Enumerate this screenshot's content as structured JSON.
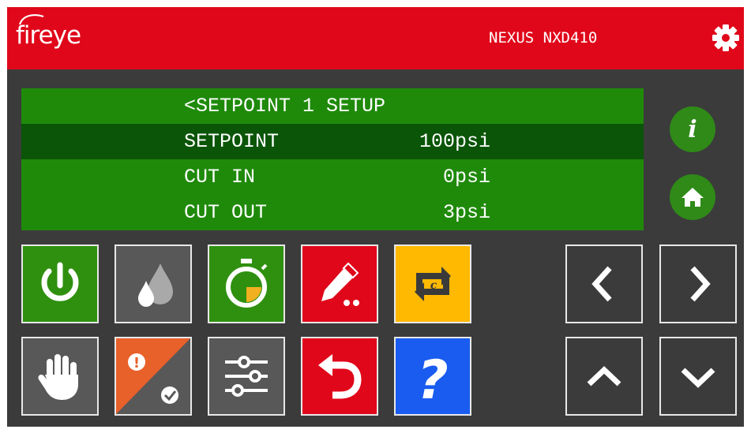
{
  "header": {
    "logo_text": "fireye",
    "model_name": "NEXUS NXD410",
    "settings_icon": "gear-icon"
  },
  "colors": {
    "header_red": "#e0071a",
    "panel_bg": "#3b3b3b",
    "lcd_green": "#1f8a0a",
    "lcd_selected": "#0a5508",
    "button_green": "#2f9010",
    "button_gray": "#585858",
    "button_red": "#e0071a",
    "button_yellow": "#ffb900",
    "button_blue": "#1a5cf0",
    "button_orange": "#e8602a"
  },
  "lcd": {
    "title": "<SETPOINT 1 SETUP",
    "rows": [
      {
        "label": "SETPOINT",
        "value": "100psi",
        "selected": true
      },
      {
        "label": "CUT IN",
        "value": "0psi",
        "selected": false
      },
      {
        "label": "CUT OUT",
        "value": "3psi",
        "selected": false
      }
    ]
  },
  "side_buttons": [
    {
      "icon": "info-icon",
      "glyph": "i"
    },
    {
      "icon": "home-icon"
    }
  ],
  "function_buttons": [
    {
      "icon": "power-icon",
      "color": "green"
    },
    {
      "icon": "flame-drops-icon",
      "color": "gray"
    },
    {
      "icon": "stopwatch-icon",
      "color": "green"
    },
    {
      "icon": "pencil-edit-icon",
      "color": "red"
    },
    {
      "icon": "cycle-c-icon",
      "color": "yellow",
      "glyph": "c"
    },
    {
      "icon": "hand-stop-icon",
      "color": "gray"
    },
    {
      "icon": "alarm-check-icon",
      "color": "orange-gray",
      "glyph": "!"
    },
    {
      "icon": "sliders-icon",
      "color": "gray"
    },
    {
      "icon": "undo-icon",
      "color": "red"
    },
    {
      "icon": "help-icon",
      "color": "blue",
      "glyph": "?"
    }
  ],
  "nav_buttons": [
    {
      "icon": "chevron-left-icon"
    },
    {
      "icon": "chevron-right-icon"
    },
    {
      "icon": "chevron-up-icon"
    },
    {
      "icon": "chevron-down-icon"
    }
  ]
}
